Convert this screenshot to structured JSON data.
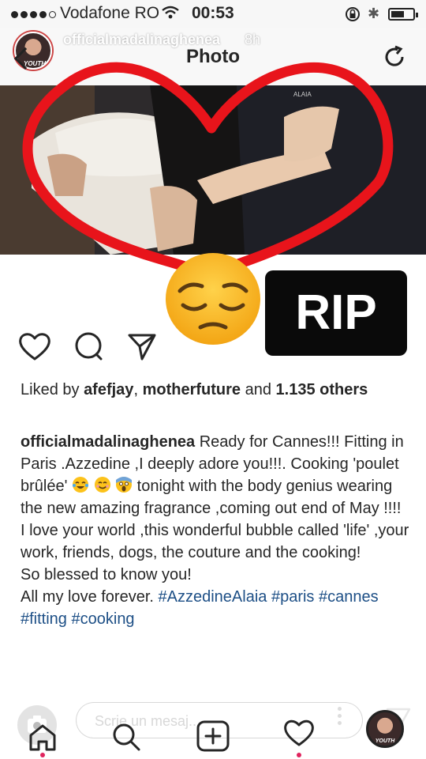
{
  "status_bar": {
    "carrier": "Vodafone RO",
    "time": "00:53"
  },
  "story_header": {
    "username": "officialmadalinaghenea",
    "time_ago": "8h",
    "avatar_label": "YOUTH"
  },
  "header": {
    "title": "Photo"
  },
  "overlay": {
    "sticker_text": "RIP",
    "emoji": "pensive-face"
  },
  "post": {
    "likes_prefix": "Liked by",
    "liker_1": "afefjay",
    "liker_sep": ",",
    "liker_2": "motherfuture",
    "likes_and": "and",
    "others_count": "1.135 others",
    "caption_user": "officialmadalinaghenea",
    "caption_line_1": "Ready for Cannes!!! Fitting in Paris .Azzedine ,I deeply adore you!!!. Cooking 'poulet brûlée'",
    "caption_line_2": "tonight with the body genius wearing the new amazing fragrance ,coming out end of May !!!!",
    "caption_para_2": "I love your  world ,this wonderful bubble called 'life' ,your work, friends, dogs, the couture and the cooking!",
    "caption_para_3": "So blessed to know you!",
    "caption_para_4_text": "All my love forever.",
    "hashtags": [
      "#AzzedineAlaia",
      "#paris",
      "#cannes",
      "#fitting",
      "#cooking"
    ]
  },
  "bottom_bar": {
    "comment_placeholder": "Scrie un mesaj...",
    "avatar_label": "YOUTH"
  },
  "colors": {
    "heart_outline": "#e8141b",
    "hashtag": "#1d4f86",
    "notification_dot": "#e0245e"
  }
}
